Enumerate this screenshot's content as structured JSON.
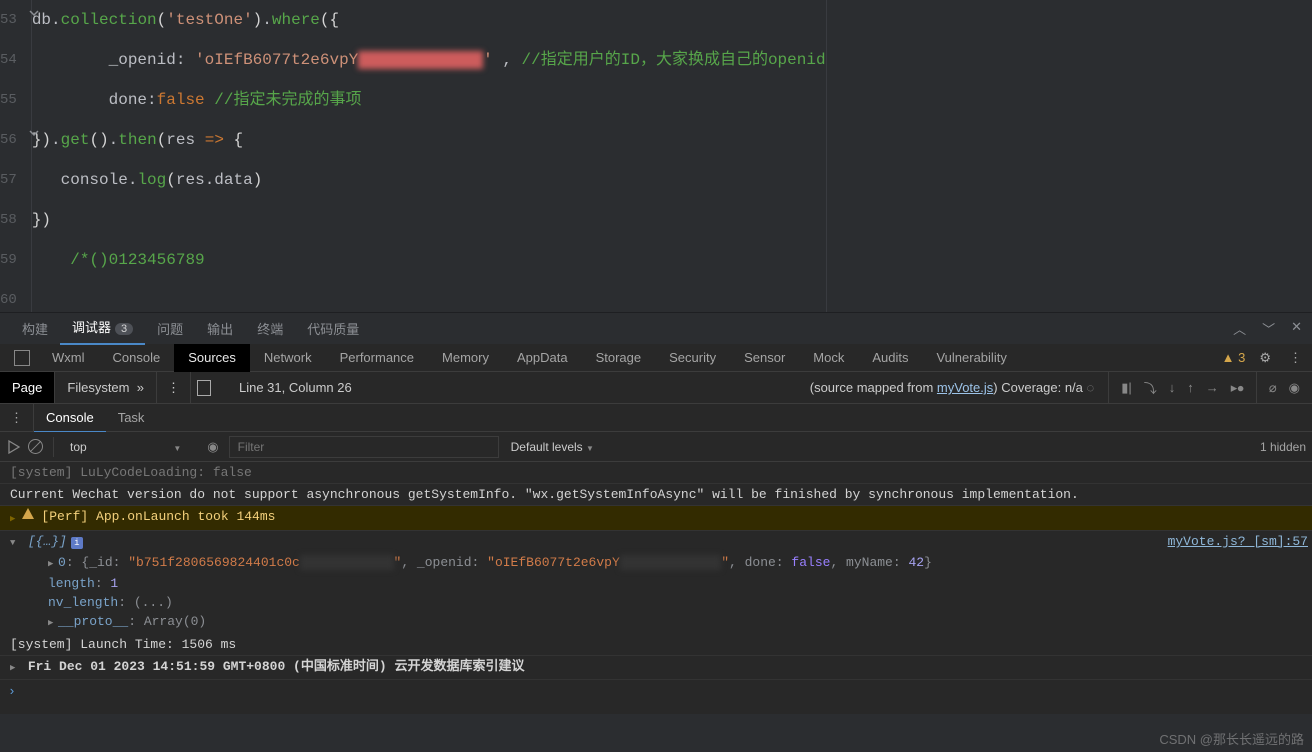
{
  "editor": {
    "line_numbers": [
      "53",
      "54",
      "55",
      "56",
      "57",
      "58",
      "59",
      "60"
    ],
    "tokens": {
      "ln53": [
        "db",
        ".",
        "collection",
        "(",
        "'testOne'",
        ")",
        ".",
        "where",
        "(",
        "{"
      ],
      "ln54": [
        "_openid",
        ":",
        " 'oIEfB6077t2e6vpY",
        "XXXXXXXXXXXXX",
        "'",
        " , ",
        "//指定用户的ID，大家换成自己的openid"
      ],
      "ln55": [
        "done",
        ":",
        "false",
        " ",
        "//指定未完成的事项"
      ],
      "ln56": [
        "}",
        ")",
        ".",
        "get",
        "(",
        ")",
        ".",
        "then",
        "(",
        "res",
        " ",
        "=>",
        " ",
        "{"
      ],
      "ln57": [
        "console",
        ".",
        "log",
        "(",
        "res",
        ".",
        "data",
        ")"
      ],
      "ln58": [
        "}",
        ")"
      ],
      "ln59": [
        "/*()0123456789"
      ]
    }
  },
  "bottom_tabs": {
    "items": [
      "构建",
      "调试器",
      "问题",
      "输出",
      "终端",
      "代码质量"
    ],
    "active_index": 1,
    "badge": "3"
  },
  "devtools": {
    "tabs": [
      "Wxml",
      "Console",
      "Sources",
      "Network",
      "Performance",
      "Memory",
      "AppData",
      "Storage",
      "Security",
      "Sensor",
      "Mock",
      "Audits",
      "Vulnerability"
    ],
    "active_index": 2,
    "warning_count": "3"
  },
  "sources": {
    "sidebar": [
      "Page",
      "Filesystem"
    ],
    "active_sidebar": 0,
    "status": "Line 31, Column 26",
    "mapped_prefix": "(source mapped from ",
    "mapped_link": "myVote.js",
    "mapped_suffix": ") Coverage: n/a",
    "debug_icons": [
      "▶|",
      "⤵",
      "↷",
      "↥",
      "→⦁",
      "▮▶"
    ],
    "debug_icons2": [
      "⌀",
      "⦿"
    ]
  },
  "console_tabs": {
    "items": [
      "Console",
      "Task"
    ],
    "active_index": 0
  },
  "console_tools": {
    "context": "top",
    "filter_placeholder": "Filter",
    "levels": "Default levels",
    "hidden": "1 hidden"
  },
  "console": {
    "trunc_line": "[system] LuLyCodeLoading: false",
    "wechat_msg": "Current Wechat version do not support asynchronous getSystemInfo. \"wx.getSystemInfoAsync\" will be finished by synchronous implementation.",
    "perf_msg": "[Perf] App.onLaunch took 144ms",
    "array_head": "[{…}]",
    "src_link": "myVote.js? [sm]:57",
    "entry": {
      "idx": "0",
      "_id": "\"b751f2806569824401c0c",
      "_id_hidden": "XXXXXXXXXXXX",
      "_id_end": "\"",
      "_openid": "\"oIEfB6077t2e6vpY",
      "_openid_hidden": "XXXXXXXXXXXXX",
      "_openid_end": "\"",
      "done": "false",
      "myName": "42"
    },
    "length_k": "length",
    "length_v": "1",
    "nvlength_k": "nv_length",
    "nvlength_v": "(...)",
    "proto_k": "__proto__",
    "proto_v": "Array(0)",
    "launch": "[system] Launch Time: 1506 ms",
    "final": "Fri Dec 01 2023 14:51:59 GMT+0800 (中国标准时间) 云开发数据库索引建议"
  },
  "watermark": "CSDN @那长长遥远的路"
}
